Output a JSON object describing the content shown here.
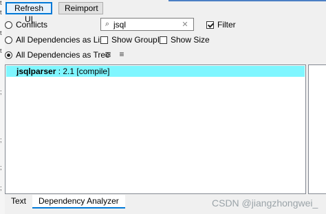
{
  "toolbar": {
    "refresh_label": "Refresh UI",
    "reimport_label": "Reimport"
  },
  "modes": [
    {
      "label": "Conflicts",
      "selected": false
    },
    {
      "label": "All Dependencies as List",
      "selected": false
    },
    {
      "label": "All Dependencies as Tree",
      "selected": true
    }
  ],
  "search": {
    "value": "jsql",
    "icon": "search-icon"
  },
  "filter": {
    "label": "Filter",
    "checked": true
  },
  "options": {
    "show_groupid": {
      "label": "Show GroupId",
      "checked": false
    },
    "show_size": {
      "label": "Show Size",
      "checked": false
    }
  },
  "tree": {
    "items": [
      {
        "name": "jsqlparser",
        "detail": " : 2.1 [compile]",
        "selected": true
      }
    ]
  },
  "tabs": [
    {
      "label": "Text",
      "active": false
    },
    {
      "label": "Dependency Analyzer",
      "active": true
    }
  ],
  "watermark": "CSDN @jiangzhongwei_",
  "colors": {
    "selection": "#7ff6ff",
    "accent": "#0078d7"
  }
}
